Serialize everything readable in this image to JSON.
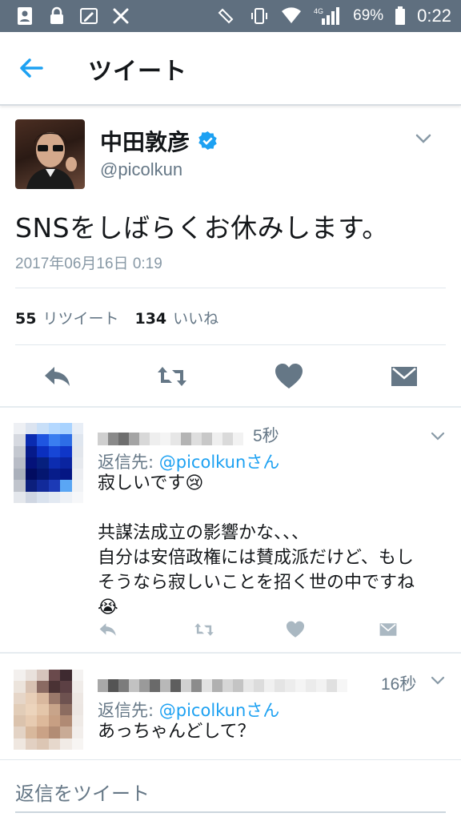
{
  "status_bar": {
    "battery_percent": "69%",
    "network": "4G",
    "time": "0:22"
  },
  "header": {
    "title": "ツイート"
  },
  "tweet": {
    "display_name": "中田敦彦",
    "handle": "@picolkun",
    "text": "SNSをしばらくお休みします。",
    "timestamp": "2017年06月16日 0:19",
    "retweet_count": "55",
    "retweet_label": "リツイート",
    "like_count": "134",
    "like_label": "いいね"
  },
  "replies": [
    {
      "time": "5秒",
      "reply_to_prefix": "返信先: ",
      "reply_to_handle": "@picolkun",
      "reply_to_suffix": "さん",
      "lines": [
        "寂しいです😢",
        "",
        "共謀法成立の影響かな、、、",
        "自分は安倍政権には賛成派だけど、もし",
        "そうなら寂しいことを招く世の中ですね",
        "😭"
      ]
    },
    {
      "time": "16秒",
      "reply_to_prefix": "返信先: ",
      "reply_to_handle": "@picolkun",
      "reply_to_suffix": "さん",
      "lines": [
        "あっちゃんどして？"
      ]
    }
  ],
  "compose": {
    "placeholder": "返信をツイート"
  },
  "colors": {
    "accent": "#1da1f2",
    "icon_gray": "#657786",
    "status_bar": "#5f6f7f"
  }
}
